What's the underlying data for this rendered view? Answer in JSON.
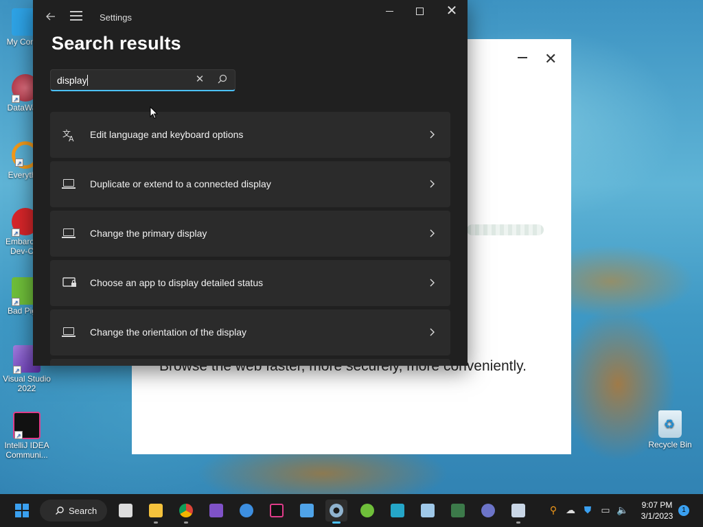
{
  "desktop": {
    "icons": [
      {
        "label": "My Com...",
        "icon": "computer-icon",
        "color": "#2ea3e6"
      },
      {
        "label": "DataWa...",
        "icon": "datawarrior-icon",
        "color": "#c8495c"
      },
      {
        "label": "Everyth...",
        "icon": "everything-search-icon",
        "color": "#f39a1a"
      },
      {
        "label": "Embarca... Dev-C...",
        "icon": "dev-cpp-icon",
        "color": "#d8262a"
      },
      {
        "label": "Bad Pig...",
        "icon": "bad-piggies-icon",
        "color": "#6fbf3a"
      },
      {
        "label": "Visual Studio 2022",
        "icon": "visual-studio-icon",
        "color": "#7f52c8"
      },
      {
        "label": "IntelliJ IDEA Communi...",
        "icon": "intellij-idea-icon",
        "color": "#111111"
      }
    ],
    "recycle_bin_label": "Recycle Bin"
  },
  "background_window": {
    "tagline": "Browse the web faster, more securely, more conveniently."
  },
  "settings": {
    "title": "Settings",
    "page_title": "Search results",
    "search": {
      "value": "display",
      "clear_icon": "close-icon",
      "search_icon": "search-icon"
    },
    "results": [
      {
        "label": "Edit language and keyboard options",
        "icon": "language-keyboard-icon"
      },
      {
        "label": "Duplicate or extend to a connected display",
        "icon": "laptop-icon"
      },
      {
        "label": "Change the primary display",
        "icon": "laptop-icon"
      },
      {
        "label": "Choose an app to display detailed status",
        "icon": "lock-screen-icon"
      },
      {
        "label": "Change the orientation of the display",
        "icon": "laptop-icon"
      }
    ]
  },
  "taskbar": {
    "search_label": "Search",
    "clock_time": "9:07 PM",
    "clock_date": "3/1/2023",
    "notification_count": "1",
    "accent": "#4cc2ff"
  }
}
